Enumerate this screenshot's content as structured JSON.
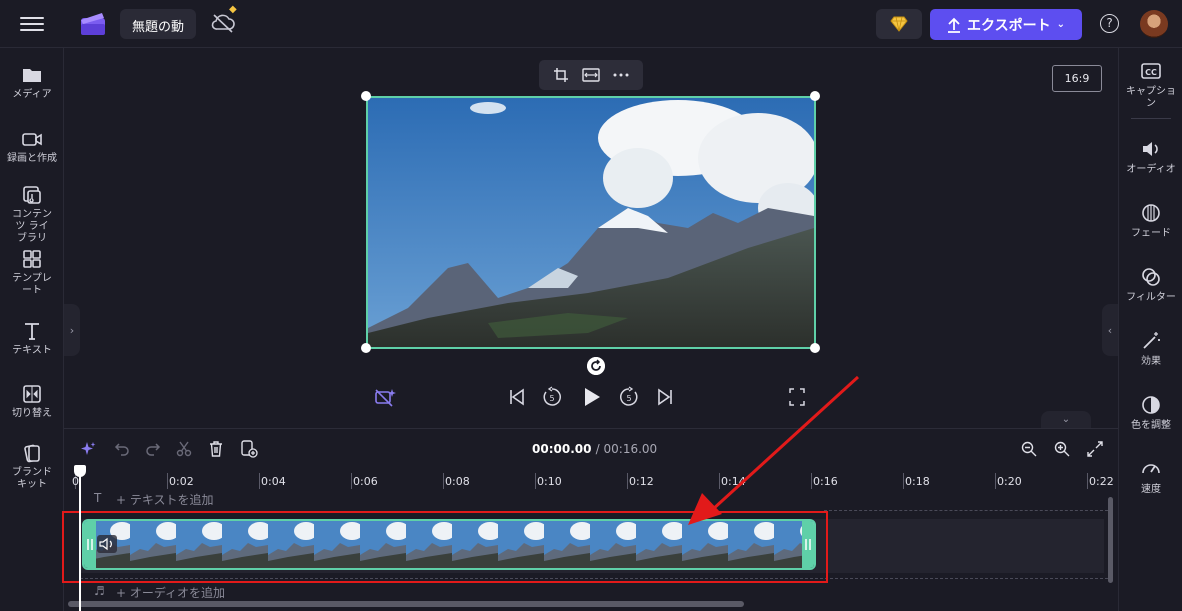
{
  "topbar": {
    "project_title": "無題の動",
    "export_label": "エクスポート",
    "help_label": "?"
  },
  "left_sidebar": {
    "items": [
      {
        "label": "メディア",
        "icon": "folder-icon"
      },
      {
        "label": "録画と作成",
        "icon": "camera-icon"
      },
      {
        "label": "コンテンツ ライブラリ",
        "icon": "content-library-icon"
      },
      {
        "label": "テンプレート",
        "icon": "template-icon"
      },
      {
        "label": "テキスト",
        "icon": "text-icon"
      },
      {
        "label": "切り替え",
        "icon": "transition-icon"
      },
      {
        "label": "ブランド キット",
        "icon": "brand-kit-icon"
      }
    ]
  },
  "right_sidebar": {
    "items": [
      {
        "label": "キャプション",
        "icon": "cc-icon"
      },
      {
        "label": "オーディオ",
        "icon": "speaker-icon"
      },
      {
        "label": "フェード",
        "icon": "fade-icon"
      },
      {
        "label": "フィルター",
        "icon": "filter-icon"
      },
      {
        "label": "効果",
        "icon": "magic-wand-icon"
      },
      {
        "label": "色を調整",
        "icon": "color-adjust-icon"
      },
      {
        "label": "速度",
        "icon": "speedometer-icon"
      }
    ]
  },
  "stage": {
    "aspect_ratio": "16:9"
  },
  "timeline": {
    "current_time": "00:00.00",
    "duration": "/ 00:16.00",
    "ticks": [
      "0",
      "0:02",
      "0:04",
      "0:06",
      "0:08",
      "0:10",
      "0:12",
      "0:14",
      "0:16",
      "0:18",
      "0:20",
      "0:22"
    ],
    "add_text_label": "+ テキストを追加",
    "add_audio_label": "+ オーディオを追加"
  },
  "colors": {
    "accent": "#5d4ef0",
    "clip_border": "#5fd0a8",
    "annotation_red": "#e21a1a",
    "background": "#1b1b25"
  }
}
